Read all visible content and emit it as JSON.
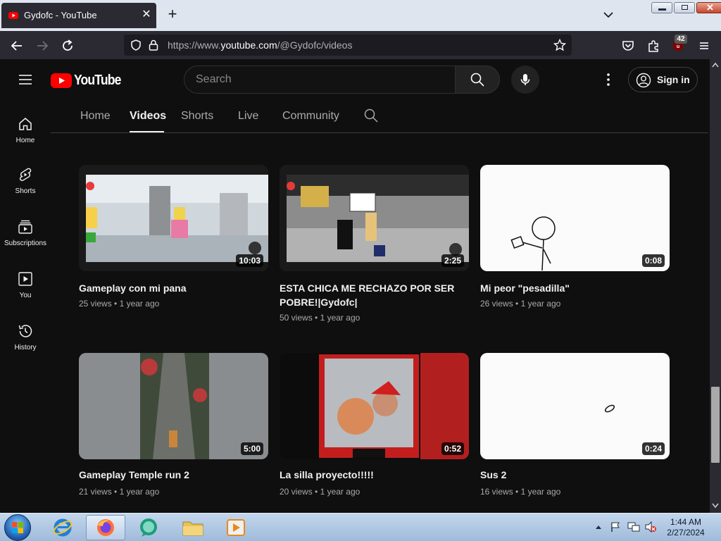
{
  "browser": {
    "tab_title": "Gydofc - YouTube",
    "url_prefix": "https://www.",
    "url_domain": "youtube.com",
    "url_path": "/@Gydofc/videos",
    "extension_badge": "42"
  },
  "header": {
    "logo_text": "YouTube",
    "search_placeholder": "Search",
    "signin_label": "Sign in"
  },
  "guide": [
    {
      "label": "Home",
      "icon": "home-icon"
    },
    {
      "label": "Shorts",
      "icon": "shorts-icon"
    },
    {
      "label": "Subscriptions",
      "icon": "subscriptions-icon"
    },
    {
      "label": "You",
      "icon": "you-icon"
    },
    {
      "label": "History",
      "icon": "history-icon"
    }
  ],
  "channel_tabs": [
    "Home",
    "Videos",
    "Shorts",
    "Live",
    "Community"
  ],
  "active_tab": "Videos",
  "videos": [
    {
      "title": "Gameplay con mi pana",
      "views": "25 views",
      "age": "1 year ago",
      "duration": "10:03"
    },
    {
      "title": "ESTA CHICA ME RECHAZO POR SER POBRE!|Gydofc|",
      "views": "50 views",
      "age": "1 year ago",
      "duration": "2:25"
    },
    {
      "title": "Mi peor \"pesadilla\"",
      "views": "26 views",
      "age": "1 year ago",
      "duration": "0:08"
    },
    {
      "title": "Gameplay Temple run 2",
      "views": "21 views",
      "age": "1 year ago",
      "duration": "5:00"
    },
    {
      "title": "La silla proyecto!!!!!",
      "views": "20 views",
      "age": "1 year ago",
      "duration": "0:52"
    },
    {
      "title": "Sus 2",
      "views": "16 views",
      "age": "1 year ago",
      "duration": "0:24"
    }
  ],
  "meta_separator": "•",
  "taskbar": {
    "time": "1:44 AM",
    "date": "2/27/2024"
  },
  "colors": {
    "youtube_red": "#ff0000",
    "page_bg": "#0f0f0f",
    "browser_chrome": "#2b2a33"
  }
}
